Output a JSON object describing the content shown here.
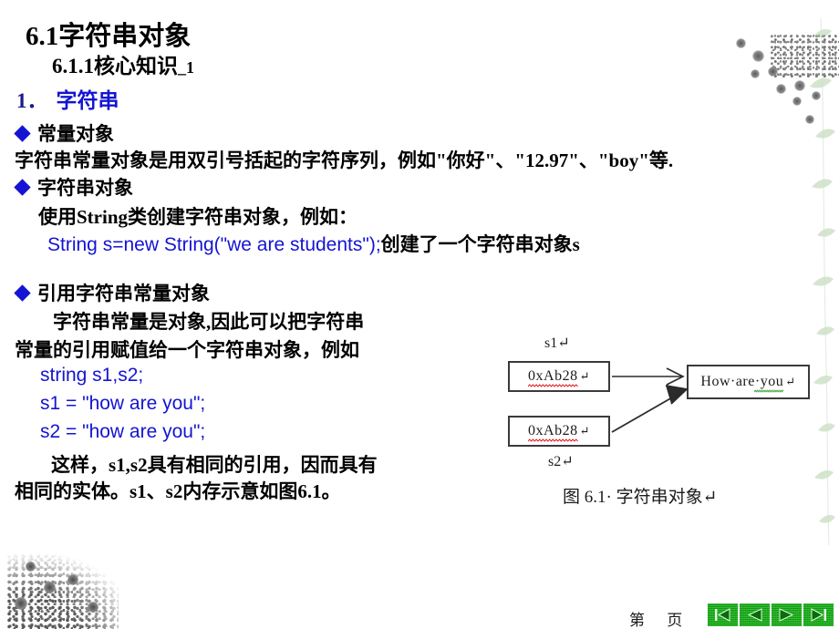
{
  "slide": {
    "title_main": "6.1字符串对象",
    "title_sub": "6.1.1核心知识",
    "title_sub_suffix": "_1",
    "section_number": "1．",
    "section_label": "字符串"
  },
  "bullets": {
    "b1_label": "常量对象",
    "b1_body": "字符串常量对象是用双引号括起的字符序列，例如\"你好\"、\"12.97\"、\"boy\"等.",
    "b2_label": "字符串对象",
    "b2_body": "使用String类创建字符串对象，例如：",
    "b2_code": "String s=new String(\"we are students\");",
    "b2_code_tail": "创建了一个字符串对象s",
    "b3_label": "引用字符串常量对象",
    "b3_body_l1": "字符串常量是对象,因此可以把字符串",
    "b3_body_l2": "常量的引用赋值给一个字符串对象，例如",
    "b3_code_l1": "string s1,s2;",
    "b3_code_l2": "s1 = \"how are you\";",
    "b3_code_l3": "s2 = \"how are you\";",
    "b3_tail_l1": "这样，s1,s2具有相同的引用，因而具有",
    "b3_tail_l2": "相同的实体。s1、s2内存示意如图6.1。"
  },
  "figure": {
    "label_s1": "s1↵",
    "label_s2": "s2↵",
    "box_s1_value": "0xAb28",
    "box_s2_value": "0xAb28",
    "box_value_text": "How·are·you",
    "pilcrow": "↵",
    "caption": "图 6.1· 字符串对象↵"
  },
  "footer": {
    "page_text": "第 页",
    "nav_first": "|◀",
    "nav_prev": "◀",
    "nav_next": "▶",
    "nav_last": "▶|"
  },
  "colors": {
    "accent_blue": "#1414d2",
    "dark_blue": "#1a1a8c",
    "nav_green": "#0aaa0a",
    "squiggle_red": "#e01b1b",
    "squiggle_green": "#1d8f1d"
  }
}
